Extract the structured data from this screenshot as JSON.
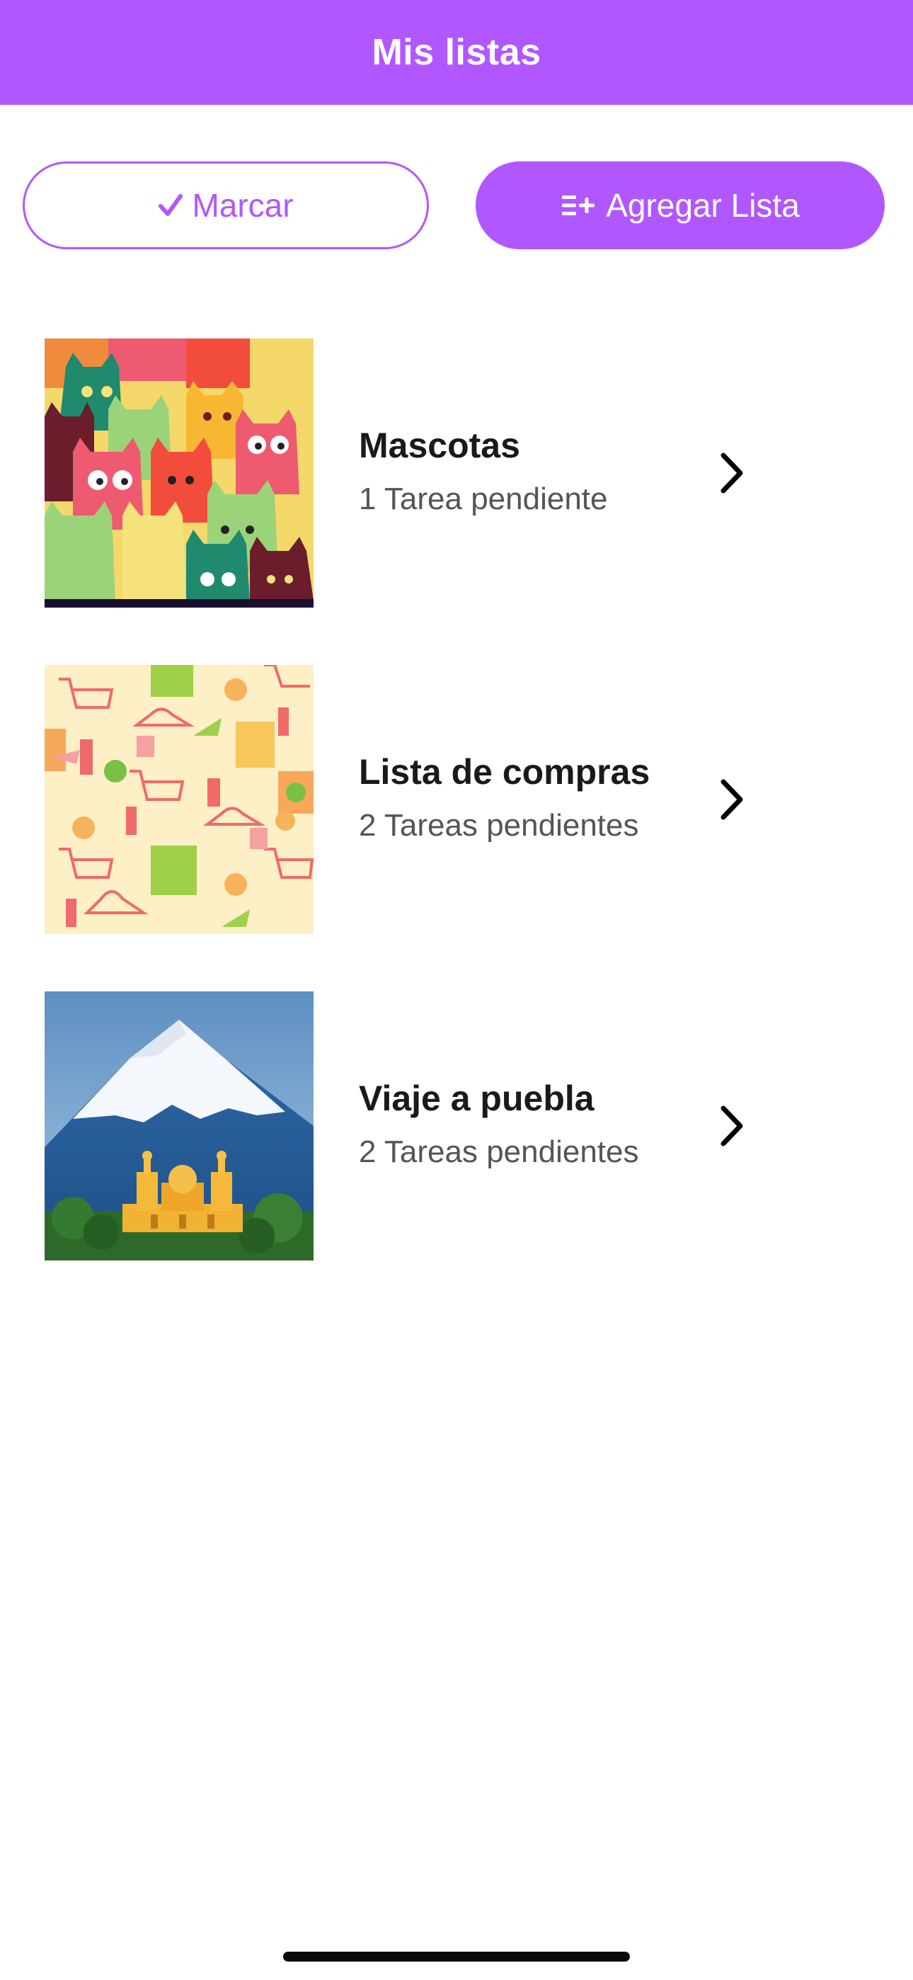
{
  "header": {
    "title": "Mis listas"
  },
  "toolbar": {
    "mark_label": "Marcar",
    "add_label": "Agregar Lista"
  },
  "lists": [
    {
      "title": "Mascotas",
      "subtitle": "1 Tarea pendiente",
      "image": "colorful-cats-pattern"
    },
    {
      "title": "Lista de compras",
      "subtitle": "2 Tareas pendientes",
      "image": "shopping-pattern"
    },
    {
      "title": "Viaje a puebla",
      "subtitle": "2 Tareas pendientes",
      "image": "volcano-church-photo"
    }
  ],
  "colors": {
    "accent": "#b157ff",
    "title_text": "#1a1a1a",
    "subtitle_text": "#555555"
  }
}
